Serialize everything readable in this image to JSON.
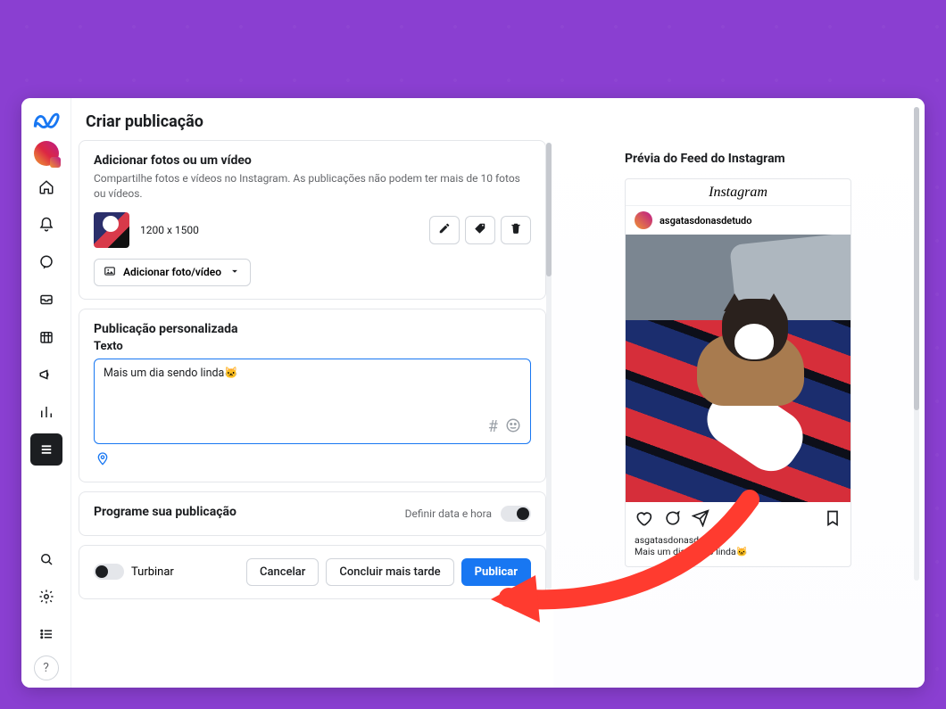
{
  "page": {
    "title": "Criar publicação"
  },
  "media": {
    "heading": "Adicionar fotos ou um vídeo",
    "subtext": "Compartilhe fotos e vídeos no Instagram. As publicações não podem ter mais de 10 fotos ou vídeos.",
    "thumb_size": "1200 x 1500",
    "add_button": "Adicionar foto/vídeo"
  },
  "custom": {
    "heading": "Publicação personalizada",
    "text_label": "Texto",
    "text_value": "Mais um dia sendo linda🐱"
  },
  "schedule": {
    "heading": "Programe sua publicação",
    "toggle_label": "Definir data e hora",
    "toggle_on": false
  },
  "footer": {
    "turbo_label": "Turbinar",
    "turbo_on": false,
    "cancel": "Cancelar",
    "later": "Concluir mais tarde",
    "publish": "Publicar"
  },
  "preview": {
    "heading": "Prévia do Feed do Instagram",
    "brand": "Instagram",
    "username": "asgatasdonasdetudo",
    "caption_user": "asgatasdonasdetudo",
    "caption_text": "Mais um dia sendo linda🐱"
  },
  "colors": {
    "accent": "#1877f2",
    "annotation": "#ff3b2f"
  }
}
